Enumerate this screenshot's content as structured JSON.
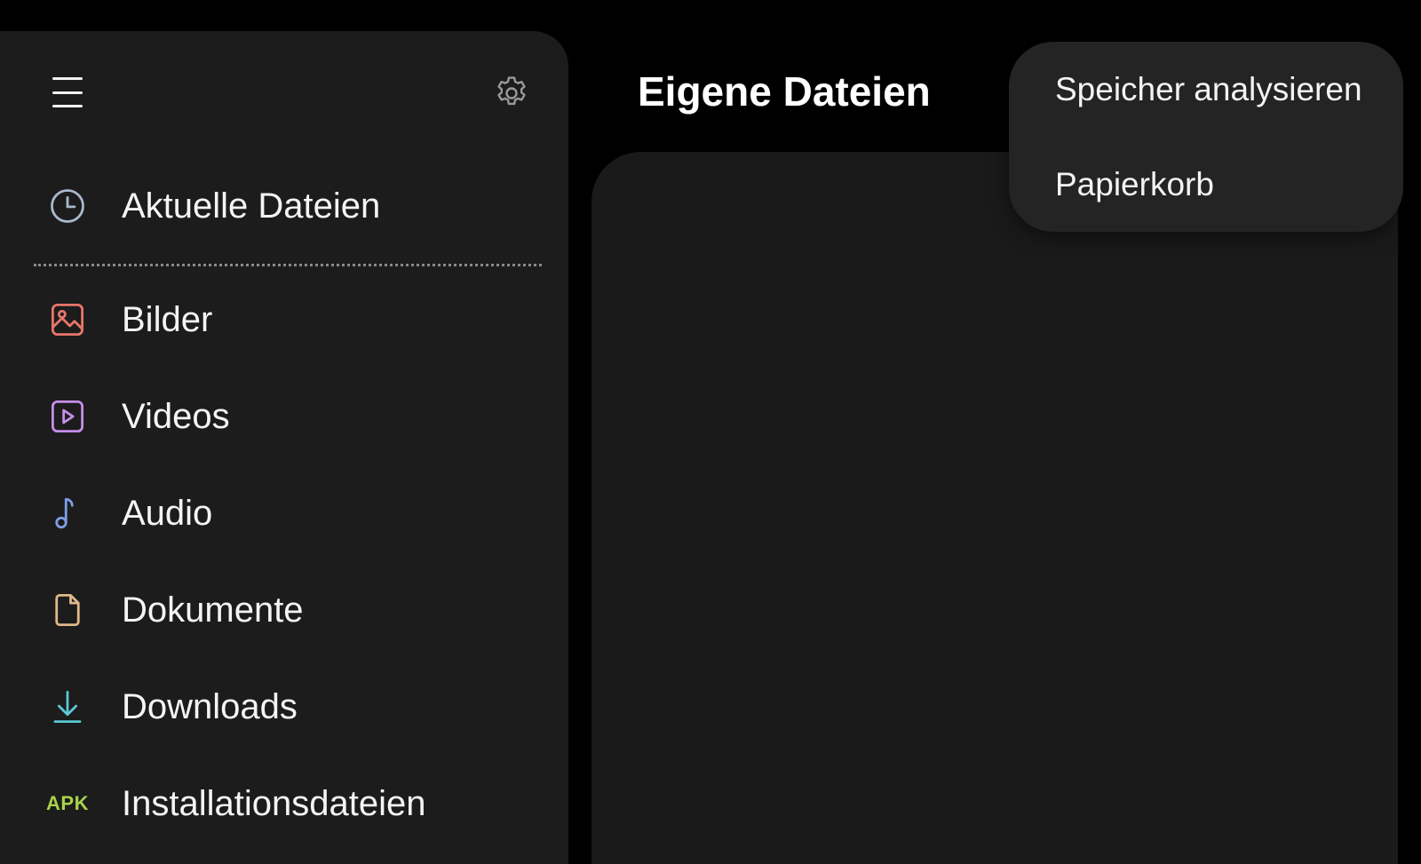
{
  "header": {
    "title": "Eigene Dateien"
  },
  "drawer": {
    "menu_icon": "hamburger-menu-icon",
    "settings_icon": "gear-icon",
    "recent": {
      "label": "Aktuelle Dateien",
      "icon": "clock-icon",
      "color": "#a9b8cc"
    },
    "categories": [
      {
        "label": "Bilder",
        "icon": "image-icon",
        "color": "#e8766a"
      },
      {
        "label": "Videos",
        "icon": "video-icon",
        "color": "#c58ee8"
      },
      {
        "label": "Audio",
        "icon": "music-note-icon",
        "color": "#7f9de8"
      },
      {
        "label": "Dokumente",
        "icon": "document-icon",
        "color": "#e0b98a"
      },
      {
        "label": "Downloads",
        "icon": "download-icon",
        "color": "#5cc8d6"
      },
      {
        "label": "Installationsdateien",
        "icon": "apk-icon",
        "icon_text": "APK",
        "color": "#a8d24a"
      }
    ]
  },
  "popup_menu": {
    "items": [
      {
        "label": "Speicher analysieren"
      },
      {
        "label": "Papierkorb"
      }
    ]
  }
}
